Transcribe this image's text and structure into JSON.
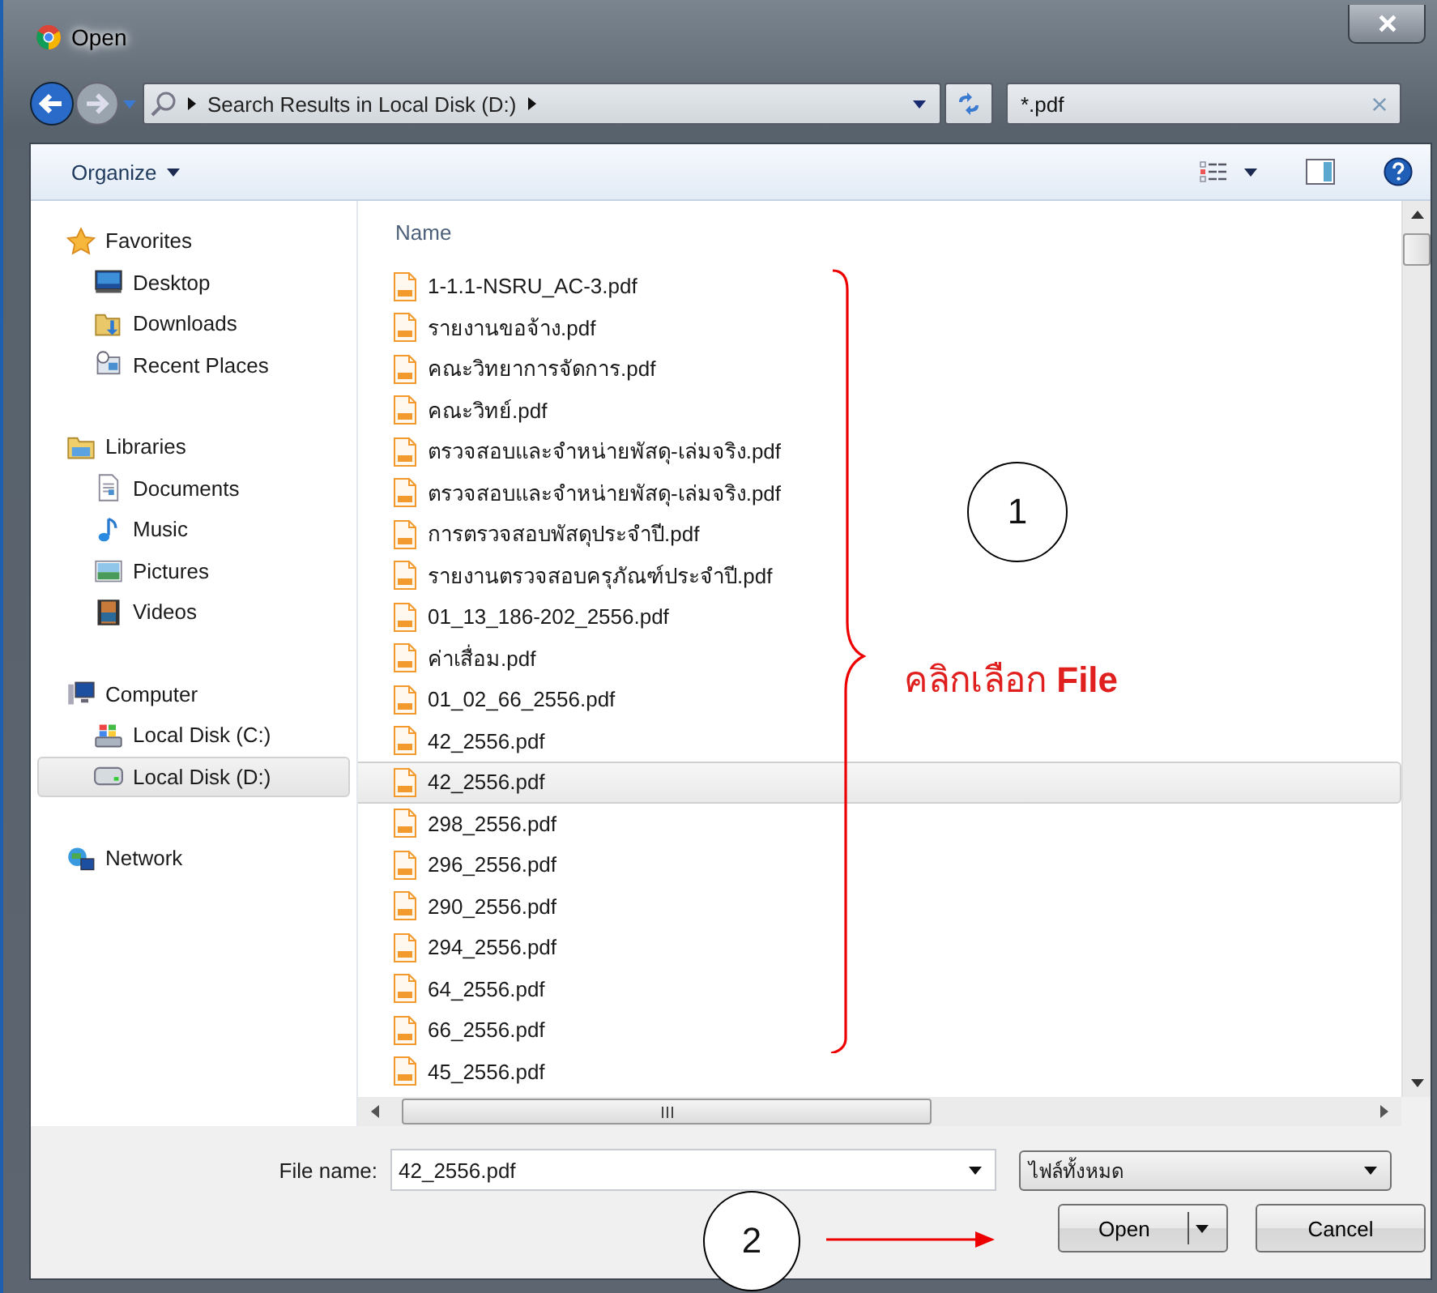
{
  "window": {
    "title": "Open"
  },
  "address": {
    "path": "Search Results in Local Disk (D:)"
  },
  "search": {
    "value": "*.pdf"
  },
  "toolbar": {
    "organize": "Organize"
  },
  "sidebar": {
    "groups": [
      {
        "label": "Favorites",
        "kind": "star",
        "selected": false,
        "items": [
          {
            "label": "Desktop",
            "kind": "desktop",
            "selected": false
          },
          {
            "label": "Downloads",
            "kind": "downloads",
            "selected": false
          },
          {
            "label": "Recent Places",
            "kind": "recent",
            "selected": false
          }
        ]
      },
      {
        "label": "Libraries",
        "kind": "library",
        "selected": false,
        "items": [
          {
            "label": "Documents",
            "kind": "documents",
            "selected": false
          },
          {
            "label": "Music",
            "kind": "music",
            "selected": false
          },
          {
            "label": "Pictures",
            "kind": "pictures",
            "selected": false
          },
          {
            "label": "Videos",
            "kind": "videos",
            "selected": false
          }
        ]
      },
      {
        "label": "Computer",
        "kind": "computer",
        "selected": false,
        "items": [
          {
            "label": "Local Disk (C:)",
            "kind": "system-disk",
            "selected": false
          },
          {
            "label": "Local Disk (D:)",
            "kind": "disk",
            "selected": true
          }
        ]
      },
      {
        "label": "Network",
        "kind": "network",
        "selected": false
      }
    ]
  },
  "file_list": {
    "column": "Name",
    "files": [
      {
        "name": "1-1.1-NSRU_AC-3.pdf",
        "selected": false
      },
      {
        "name": "รายงานขอจ้าง.pdf",
        "selected": false
      },
      {
        "name": "คณะวิทยาการจัดการ.pdf",
        "selected": false
      },
      {
        "name": "คณะวิทย์.pdf",
        "selected": false
      },
      {
        "name": "ตรวจสอบและจำหน่ายพัสดุ-เล่มจริง.pdf",
        "selected": false
      },
      {
        "name": "ตรวจสอบและจำหน่ายพัสดุ-เล่มจริง.pdf",
        "selected": false
      },
      {
        "name": "การตรวจสอบพัสดุประจำปี.pdf",
        "selected": false
      },
      {
        "name": "รายงานตรวจสอบครุภัณฑ์ประจำปี.pdf",
        "selected": false
      },
      {
        "name": "01_13_186-202_2556.pdf",
        "selected": false
      },
      {
        "name": "ค่าเสื่อม.pdf",
        "selected": false
      },
      {
        "name": "01_02_66_2556.pdf",
        "selected": false
      },
      {
        "name": "42_2556.pdf",
        "selected": false
      },
      {
        "name": "42_2556.pdf",
        "selected": true
      },
      {
        "name": "298_2556.pdf",
        "selected": false
      },
      {
        "name": "296_2556.pdf",
        "selected": false
      },
      {
        "name": "290_2556.pdf",
        "selected": false
      },
      {
        "name": "294_2556.pdf",
        "selected": false
      },
      {
        "name": "64_2556.pdf",
        "selected": false
      },
      {
        "name": "66_2556.pdf",
        "selected": false
      },
      {
        "name": "45_2556.pdf",
        "selected": false
      }
    ]
  },
  "file_name": {
    "label": "File name:",
    "value": "42_2556.pdf"
  },
  "file_type": {
    "value": "ไฟล์ทั้งหมด"
  },
  "buttons": [
    {
      "label": "Open",
      "kind": "split"
    },
    {
      "label": "Cancel",
      "kind": "plain"
    }
  ],
  "annotations": [
    {
      "kind": "circle",
      "text": "1"
    },
    {
      "kind": "callout",
      "text": "คลิกเลือก **File**"
    },
    {
      "kind": "circle",
      "text": "2"
    }
  ]
}
